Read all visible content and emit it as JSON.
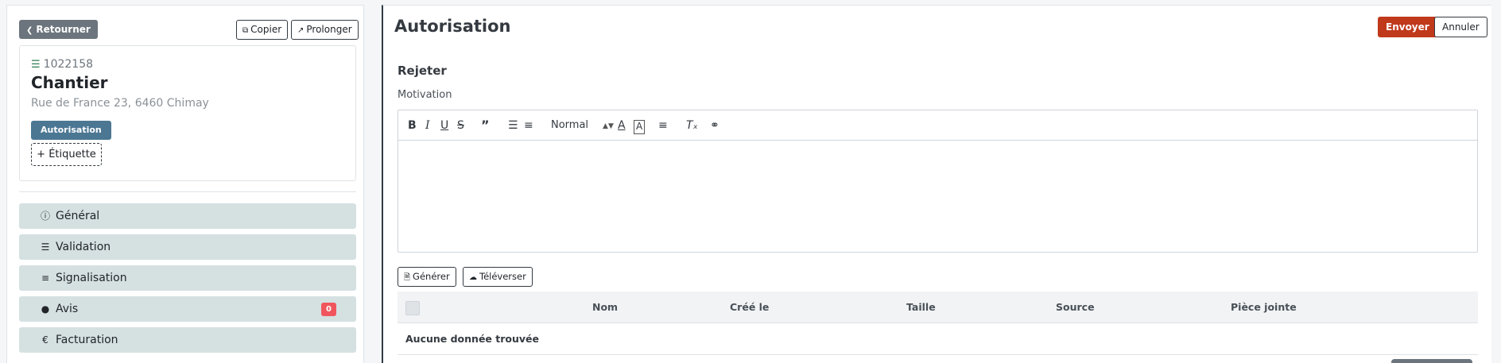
{
  "left": {
    "back_label": "Retourner",
    "copy_label": "Copier",
    "extend_label": "Prolonger",
    "card": {
      "id": "1022158",
      "title": "Chantier",
      "address": "Rue de France 23, 6460 Chimay",
      "status": "Autorisation",
      "add_tag": "+ Étiquette"
    },
    "nav": [
      {
        "label": "Général",
        "icon": "info-icon"
      },
      {
        "label": "Validation",
        "icon": "checklist-icon"
      },
      {
        "label": "Signalisation",
        "icon": "signpost-icon"
      },
      {
        "label": "Avis",
        "icon": "comment-icon",
        "count": "0"
      },
      {
        "label": "Facturation",
        "icon": "euro-icon"
      }
    ]
  },
  "main": {
    "title": "Autorisation",
    "send_label": "Envoyer",
    "cancel_label": "Annuler",
    "section_title": "Rejeter",
    "field_label": "Motivation",
    "editor": {
      "format_value": "Normal",
      "content": ""
    },
    "generate_label": "Générer",
    "upload_label": "Téléverser",
    "table": {
      "columns": [
        "Nom",
        "Créé le",
        "Taille",
        "Source",
        "Pièce jointe"
      ],
      "empty_text": "Aucune donnée trouvée"
    }
  },
  "colors": {
    "send": "#c0391b",
    "status_badge": "#4b7793",
    "nav_bg": "#d5e0e1",
    "count_badge": "#f0555e"
  }
}
